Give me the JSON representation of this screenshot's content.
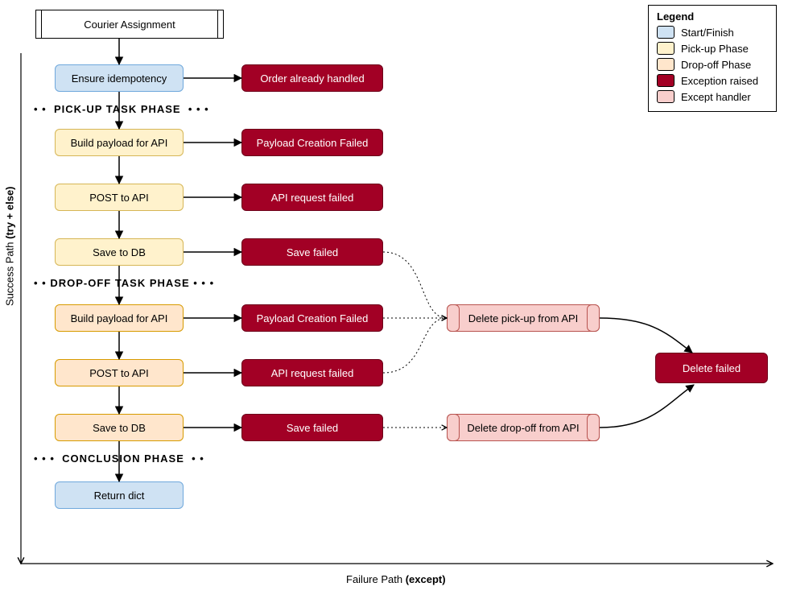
{
  "title": "Courier Assignment",
  "nodes": {
    "ensure_idempotency": "Ensure idempotency",
    "build_payload_1": "Build payload for API",
    "post_api_1": "POST to API",
    "save_db_1": "Save to DB",
    "build_payload_2": "Build payload for API",
    "post_api_2": "POST to API",
    "save_db_2": "Save to DB",
    "return_dict": "Return dict",
    "order_handled": "Order already handled",
    "payload_failed_1": "Payload Creation Failed",
    "api_failed_1": "API request failed",
    "save_failed_1": "Save failed",
    "payload_failed_2": "Payload Creation Failed",
    "api_failed_2": "API request failed",
    "save_failed_2": "Save failed",
    "delete_pickup": "Delete pick-up from API",
    "delete_dropoff": "Delete drop-off from API",
    "delete_failed": "Delete failed"
  },
  "phases": {
    "pickup": "PICK-UP TASK PHASE",
    "dropoff": "DROP-OFF TASK PHASE",
    "conclusion": "CONCLUSION PHASE"
  },
  "axes": {
    "success_plain": "Success Path ",
    "success_bold": "(try + else)",
    "failure_plain": "Failure Path ",
    "failure_bold": "(except)"
  },
  "legend": {
    "title": "Legend",
    "start": "Start/Finish",
    "pickup": "Pick-up Phase",
    "dropoff": "Drop-off Phase",
    "exception": "Exception raised",
    "handler": "Except handler"
  }
}
